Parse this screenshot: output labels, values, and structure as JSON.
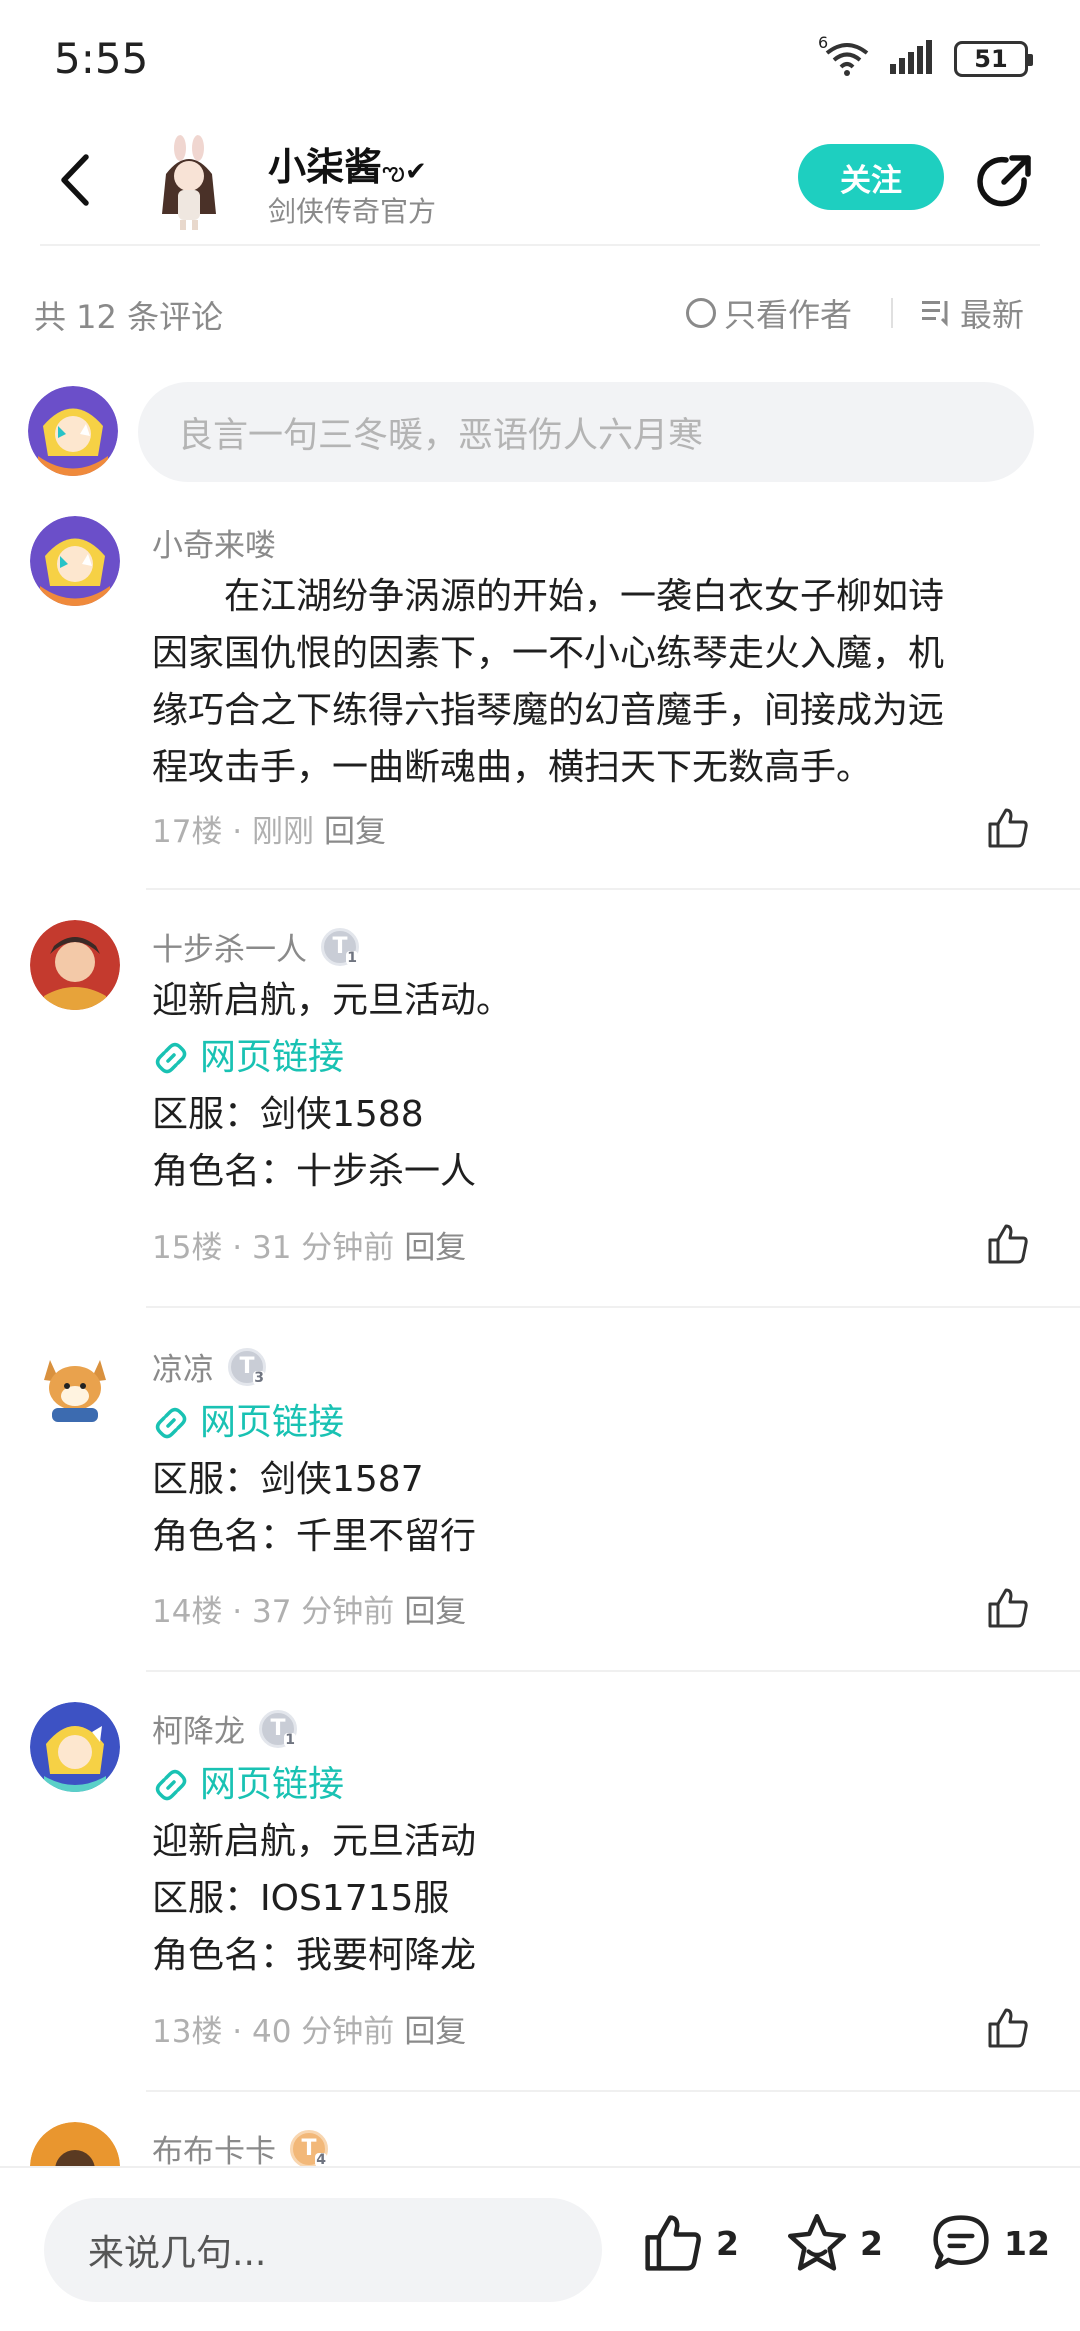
{
  "status_bar": {
    "time": "5:55",
    "network": "6",
    "battery": "51"
  },
  "header": {
    "author_name": "小柒酱",
    "author_subtitle": "剑侠传奇官方",
    "follow_label": "关注"
  },
  "filter": {
    "count_label": "共 12 条评论",
    "only_author_label": "只看作者",
    "sort_label": "最新"
  },
  "top_input": {
    "placeholder": "良言一句三冬暖，恶语伤人六月寒"
  },
  "comments": [
    {
      "name": "小奇来喽",
      "lines": [
        "　　在江湖纷争涡源的开始，一袭白衣女子柳如诗",
        "因家国仇恨的因素下，一不小心练琴走火入魔，机",
        "缘巧合之下练得六指琴魔的幻音魔手，间接成为远",
        "程攻击手，一曲断魂曲，横扫天下无数高手。"
      ],
      "floor": "17楼 · 刚刚",
      "reply": "回复"
    },
    {
      "name": "十步杀一人",
      "level": "1",
      "lines": [
        "迎新启航，元旦活动。"
      ],
      "link": "网页链接",
      "lines_after": [
        "区服：剑侠1588",
        "角色名：十步杀一人"
      ],
      "floor": "15楼 · 31 分钟前",
      "reply": "回复"
    },
    {
      "name": "凉凉",
      "level": "3",
      "link": "网页链接",
      "lines_after": [
        "区服：剑侠1587",
        "角色名：千里不留行"
      ],
      "floor": "14楼 · 37 分钟前",
      "reply": "回复"
    },
    {
      "name": "柯降龙",
      "level": "1",
      "link": "网页链接",
      "lines_after": [
        "迎新启航，元旦活动",
        "区服：IOS1715服",
        "角色名：我要柯降龙"
      ],
      "floor": "13楼 · 40 分钟前",
      "reply": "回复"
    },
    {
      "name": "布布卡卡",
      "level": "4"
    }
  ],
  "bottom_bar": {
    "input_placeholder": "来说几句...",
    "like_count": "2",
    "fav_count": "2",
    "comment_count": "12"
  },
  "colors": {
    "accent": "#1ecfc0",
    "link": "#19c2b3",
    "muted": "#8a8a8a"
  }
}
